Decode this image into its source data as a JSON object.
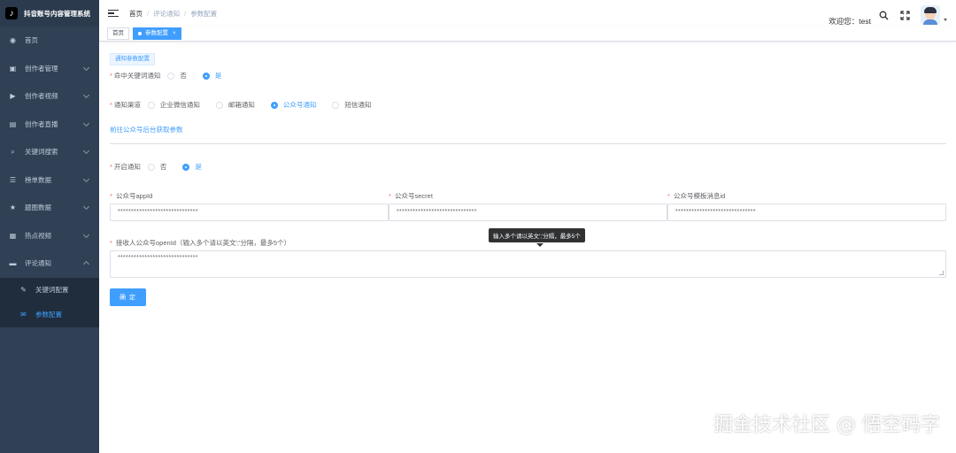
{
  "app": {
    "logo_glyph": "♪",
    "title": "抖音账号内容管理系统"
  },
  "sidebar": {
    "items": [
      {
        "label": "首页",
        "icon": "dashboard-icon",
        "glyph": "◉",
        "has_children": false
      },
      {
        "label": "创作者管理",
        "icon": "creator-manage-icon",
        "glyph": "▣",
        "has_children": true
      },
      {
        "label": "创作者视频",
        "icon": "video-icon",
        "glyph": "▶",
        "has_children": true
      },
      {
        "label": "创作者直播",
        "icon": "live-icon",
        "glyph": "▤",
        "has_children": true
      },
      {
        "label": "关键词搜索",
        "icon": "search-icon",
        "glyph": "⌕",
        "has_children": true
      },
      {
        "label": "榜单数据",
        "icon": "list-icon",
        "glyph": "☰",
        "has_children": true
      },
      {
        "label": "题图数据",
        "icon": "star-icon",
        "glyph": "★",
        "has_children": true
      },
      {
        "label": "热点视频",
        "icon": "hot-icon",
        "glyph": "▦",
        "has_children": true
      },
      {
        "label": "评论通知",
        "icon": "comment-icon",
        "glyph": "▬",
        "has_children": true,
        "expanded": true
      }
    ],
    "submenu": [
      {
        "label": "关键词配置",
        "icon": "keyword-config-icon",
        "glyph": "✎",
        "active": false
      },
      {
        "label": "参数配置",
        "icon": "param-config-icon",
        "glyph": "✉",
        "active": true
      }
    ]
  },
  "header": {
    "breadcrumb": [
      "首页",
      "评论通知",
      "参数配置"
    ],
    "breadcrumb_sep": "/",
    "welcome": "欢迎您：test"
  },
  "tags": {
    "home": "首页",
    "active": "参数配置",
    "close": "×"
  },
  "form": {
    "section_tag": "通知参数配置",
    "keyword_notify": {
      "label": "命中关键词通知",
      "options": [
        "否",
        "是"
      ],
      "selected": "是"
    },
    "channel": {
      "label": "通知渠道",
      "options": [
        "企业微信通知",
        "邮箱通知",
        "公众号通知",
        "短信通知"
      ],
      "selected": "公众号通知"
    },
    "link": "前往公众号后台获取参数",
    "enable": {
      "label": "开启通知",
      "options": [
        "否",
        "是"
      ],
      "selected": "是"
    },
    "appid": {
      "label": "公众号appId",
      "value": "******************************"
    },
    "secret": {
      "label": "公众号secret",
      "value": "******************************"
    },
    "template": {
      "label": "公众号模板消息id",
      "value": "******************************"
    },
    "openid": {
      "label": "接收人公众号openId（输入多个请以英文';'分隔，最多5个）",
      "value": "******************************"
    },
    "tooltip": "输入多个请以英文';'分隔，最多5个",
    "submit": "确 定",
    "required_mark": "*"
  },
  "watermark": "掘金技术社区 @ 悟空码字",
  "colors": {
    "primary": "#409eff",
    "sidebar": "#304156",
    "submenu": "#1f2d3d",
    "required": "#f56c6c"
  }
}
